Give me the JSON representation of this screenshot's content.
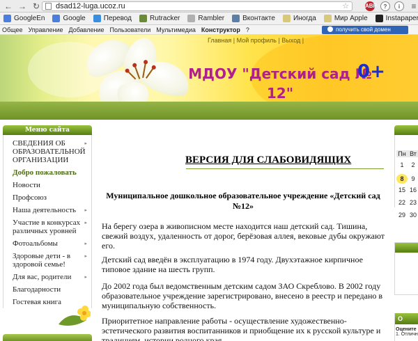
{
  "browser": {
    "url": "dsad12-luga.ucoz.ru",
    "extensions": [
      "ABP",
      "?",
      "i"
    ]
  },
  "bookmarks": [
    {
      "label": "GoogleEn",
      "color": "#4a7fe0"
    },
    {
      "label": "Google",
      "color": "#4a7fe0"
    },
    {
      "label": "Перевод",
      "color": "#3a8ee0"
    },
    {
      "label": "Rutracker",
      "color": "#6a8a3a"
    },
    {
      "label": "Rambler",
      "color": "#b0b0b0"
    },
    {
      "label": "Вконтакте",
      "color": "#5b7fa6"
    },
    {
      "label": "Иногда",
      "color": "#d8c87a"
    },
    {
      "label": "Мир Apple",
      "color": "#d8c87a"
    },
    {
      "label": "Instapaper",
      "color": "#222222"
    },
    {
      "label": "Другие закладки",
      "color": "#d8c87a"
    }
  ],
  "ucoz_bar": {
    "items": [
      "Общее",
      "Управление",
      "Добавление",
      "Пользователи",
      "Мультимедиа"
    ],
    "active": "Конструктор",
    "help": "?",
    "domain_button": "получить свой домен"
  },
  "header": {
    "nav_links": "Главная | Мой профиль | Выход |",
    "site_title": "МДОУ \"Детский сад № 12\"",
    "age_badge": "0+"
  },
  "sidebar": {
    "title": "Меню сайта",
    "items": [
      {
        "label": "СВЕДЕНИЯ ОБ ОБРАЗОВАТЕЛЬНОЙ ОРГАНИЗАЦИИ",
        "arrow": true,
        "active": false
      },
      {
        "label": "Добро пожаловать",
        "arrow": false,
        "active": true
      },
      {
        "label": "Новости",
        "arrow": false,
        "active": false
      },
      {
        "label": "Профсоюз",
        "arrow": false,
        "active": false
      },
      {
        "label": "Наша деятельность",
        "arrow": true,
        "active": false
      },
      {
        "label": "Участие в конкурсах различных уровней",
        "arrow": true,
        "active": false
      },
      {
        "label": "Фотоальбомы",
        "arrow": true,
        "active": false
      },
      {
        "label": "Здоровые дети - в здоровой семье!",
        "arrow": true,
        "active": false
      },
      {
        "label": "Для вас, родители",
        "arrow": true,
        "active": false
      },
      {
        "label": "Благодарности",
        "arrow": false,
        "active": false
      },
      {
        "label": "Гостевая книга",
        "arrow": false,
        "active": false
      }
    ]
  },
  "main": {
    "title": "ВЕРСИЯ ДЛЯ СЛАБОВИДЯЩИХ",
    "subheading": "Муниципальное дошкольное образовательное учреждение «Детский сад №12»",
    "paragraphs": [
      "На берегу озера в живописном месте находится наш детский сад. Тишина, свежий воздух, удаленность от дорог, берёзовая аллея, вековые дубы окружают его.",
      "Детский сад введён в эксплуатацию в 1974 году. Двухэтажное кирпичное типовое здание на шесть групп.",
      "До 2002 года был ведомственным детским садом ЗАО Скреблово. В 2002 году образовательное учреждение зарегистрировано, внесено в реестр и передано в муниципальную собственность.",
      "Приоритетное направление работы - осуществление художественно-эстетического развития воспитанников и приобщение их к русской культуре и традициям, истории родного края."
    ]
  },
  "calendar": {
    "weekdays": [
      "Пн",
      "Вт"
    ],
    "rows": [
      [
        "1",
        "2"
      ],
      [
        "8",
        "9"
      ],
      [
        "15",
        "16"
      ],
      [
        "22",
        "23"
      ],
      [
        "29",
        "30"
      ]
    ],
    "today": "8"
  },
  "right_box": {
    "title": "О",
    "line1": "Оцените",
    "line2": "1. Отличн"
  },
  "colors": {
    "title_magenta": "#b0208c",
    "badge_blue": "#1c2fc8",
    "menu_green": "#557d12",
    "domain_blue": "#2f64b6"
  }
}
